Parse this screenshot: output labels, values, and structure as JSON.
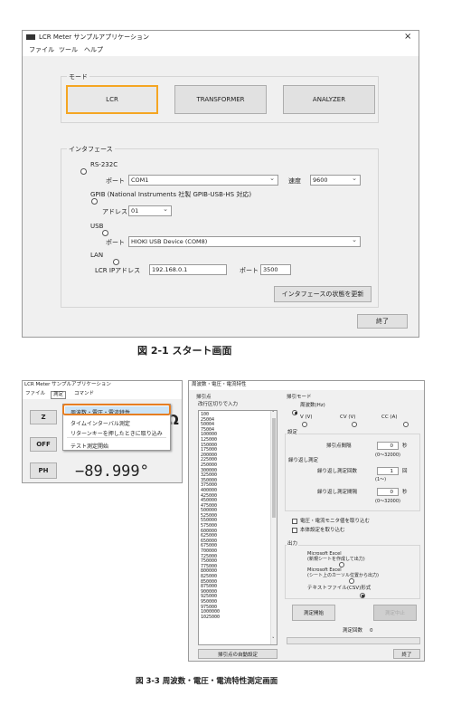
{
  "fig1": {
    "title": "LCR Meter サンプルアプリケーション",
    "close": "×",
    "menu": [
      "ファイル",
      "ツール",
      "ヘルプ"
    ],
    "mode_label": "モード",
    "mode_buttons": [
      "LCR",
      "TRANSFORMER",
      "ANALYZER"
    ],
    "interface_label": "インタフェース",
    "rs232c": "RS-232C",
    "port_label": "ポート",
    "port_value": "COM1",
    "speed_label": "速度",
    "speed_value": "9600",
    "gpib": "GPIB (National Instruments 社製 GPIB-USB-HS 対応)",
    "address_label": "アドレス",
    "address_value": "01",
    "usb": "USB",
    "usb_port_label": "ポート",
    "usb_port_value": "HIOKI USB Device (COM8)",
    "lan": "LAN",
    "ip_label": "LCR IPアドレス",
    "ip_value": "192.168.0.1",
    "lan_port_label": "ポート",
    "lan_port_value": "3500",
    "update_button": "インタフェースの状態を更新",
    "exit_button": "終了",
    "caption": "図 2-1 スタート画面",
    "selected_radio": "none"
  },
  "fig3": {
    "main_title": "LCR Meter サンプルアプリケーション",
    "main_menu": [
      "ファイル",
      "測定",
      "コマンド"
    ],
    "dropdown": [
      "周波数・電圧・電流特性",
      "タイムインターバル測定",
      "リターンキーを押したときに取り込み",
      "テスト測定開始"
    ],
    "side_buttons": [
      "Z",
      "OFF",
      "PH"
    ],
    "omega": "Ω",
    "ph_value": "−89.999°",
    "dlg_title": "周波数・電圧・電流特性",
    "sweep_label": "掃引点",
    "sweep_hint": "改行区切りで入力",
    "sweep_values": [
      "100",
      "25004",
      "50004",
      "75004",
      "100000",
      "125000",
      "150000",
      "175000",
      "200000",
      "225000",
      "250000",
      "300000",
      "325000",
      "350000",
      "375000",
      "400000",
      "425000",
      "450000",
      "475000",
      "500000",
      "525000",
      "550000",
      "575000",
      "600000",
      "625000",
      "650000",
      "675000",
      "700000",
      "725000",
      "750000",
      "775000",
      "800000",
      "825000",
      "850000",
      "875000",
      "900000",
      "925000",
      "950000",
      "975000",
      "1000000",
      "1025000"
    ],
    "auto_button": "掃引点の自動設定",
    "sweep_mode_label": "掃引モード",
    "mode_freq": "周波数(Hz)",
    "mode_v": "V (V)",
    "mode_cv": "CV (V)",
    "mode_cc": "CC (A)",
    "settings_label": "設定",
    "interval_label": "掃引点間隔",
    "interval_value": "0",
    "interval_unit": "秒",
    "interval_range": "(0〜32000)",
    "repeat_label": "繰り返し測定",
    "repeat_count_label": "繰り返し測定回数",
    "repeat_count_value": "1",
    "repeat_count_unit": "回",
    "repeat_count_range": "(1〜)",
    "repeat_interval_label": "繰り返し測定間隔",
    "repeat_interval_value": "0",
    "repeat_interval_unit": "秒",
    "repeat_interval_range": "(0〜32000)",
    "chk_monitor": "電圧・電流モニタ値を取り込む",
    "chk_setting": "本体設定を取り込む",
    "output_label": "出力",
    "out_excel_new_1": "Microsoft Excel",
    "out_excel_new_2": "(新規シートを作成して出力)",
    "out_excel_cur_1": "Microsoft Excel",
    "out_excel_cur_2": "(シート上のカーソル位置から出力)",
    "out_csv": "テキストファイル(CSV)形式",
    "start_button": "測定開始",
    "stop_button": "測定中止",
    "count_label": "測定回数",
    "count_value": "0",
    "exit_button": "終了",
    "caption": "図 3-3 周波数・電圧・電流特性測定画面"
  }
}
